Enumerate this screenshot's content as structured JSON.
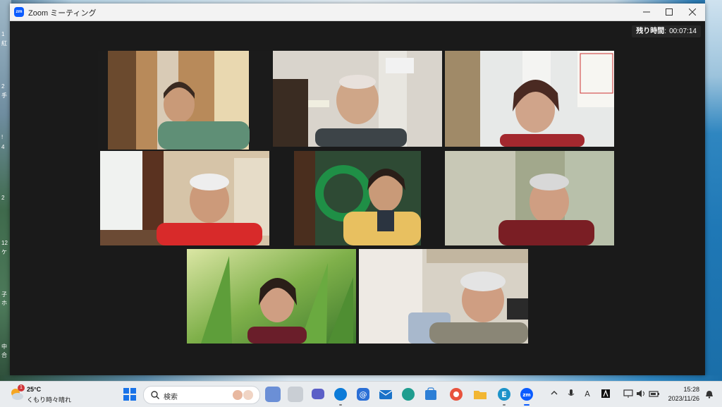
{
  "window": {
    "title": "Zoom ミーティング",
    "logo_text": "zm"
  },
  "meeting": {
    "timer_label": "残り時間",
    "timer_sep": ":",
    "timer_value": "00:07:14",
    "active_tile": 0
  },
  "desktop": {
    "left_glyphs": [
      "1",
      "紅",
      "2",
      "手",
      "!",
      "4",
      "2",
      "12",
      "ケ",
      "子",
      "ホ",
      "中",
      "合"
    ]
  },
  "taskbar": {
    "weather": {
      "temp": "25°C",
      "condition": "くもり時々晴れ",
      "badge": "1"
    },
    "search_placeholder": "検索",
    "clock": {
      "time": "15:28",
      "date": "2023/11/26"
    },
    "apps": [
      {
        "name": "chat-app-icon",
        "color": "#5b5fc7"
      },
      {
        "name": "edge-icon",
        "color": "#0c7bd8"
      },
      {
        "name": "mail-at-icon",
        "color": "#2b6fd6"
      },
      {
        "name": "outlook-mail-icon",
        "color": "#1a73c9"
      },
      {
        "name": "edge-beta-icon",
        "color": "#1f9d8f"
      },
      {
        "name": "store-icon",
        "color": "#2d7fd6"
      },
      {
        "name": "app-circle-icon",
        "color": "#e8523d"
      },
      {
        "name": "folder-icon",
        "color": "#f2b632"
      },
      {
        "name": "e-app-icon",
        "color": "#1c93c9"
      },
      {
        "name": "zoom-icon",
        "color": "#0b5cff"
      }
    ]
  }
}
